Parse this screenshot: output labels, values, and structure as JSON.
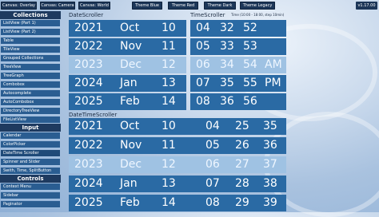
{
  "topbar": {
    "buttons": [
      "Canvas: Overlay",
      "Canvas: Camera",
      "Canvas: World",
      "Theme Blue",
      "Theme Red",
      "Theme Dark",
      "Theme Legacy"
    ],
    "version": "v1.17.00"
  },
  "sidebar": {
    "sections": [
      {
        "title": "Collections",
        "items": [
          "ListView (Part 1)",
          "ListView (Part 2)",
          "Table",
          "TileView",
          "Grouped Collections",
          "TreeView",
          "TreeGraph",
          "Combobox",
          "Autocomplete",
          "AutoCombobox",
          "DirectoryTreeView",
          "FileListView"
        ]
      },
      {
        "title": "Input",
        "items": [
          "Calendar",
          "ColorPicker",
          "DateTime Scroller",
          "Spinner and Slider",
          "Swith, Time, SplitButton"
        ]
      },
      {
        "title": "Controls",
        "items": [
          "Context Menu",
          "Sidebar",
          "Paginator"
        ]
      }
    ]
  },
  "date_scroller": {
    "label": "DateScroller",
    "rows": [
      [
        "2021",
        "Oct",
        "10"
      ],
      [
        "2022",
        "Nov",
        "11"
      ],
      [
        "2023",
        "Dec",
        "12"
      ],
      [
        "2024",
        "Jan",
        "13"
      ],
      [
        "2025",
        "Feb",
        "14"
      ]
    ],
    "selected_index": 2
  },
  "time_scroller": {
    "label": "TimeScroller",
    "hint": "Time (10:00 - 18:00, step 10min)",
    "rows": [
      [
        "04",
        "32",
        "52",
        ""
      ],
      [
        "05",
        "33",
        "53",
        ""
      ],
      [
        "06",
        "34",
        "54",
        "AM"
      ],
      [
        "07",
        "35",
        "55",
        "PM"
      ],
      [
        "08",
        "36",
        "56",
        ""
      ]
    ],
    "selected_index": 2
  },
  "datetime_scroller": {
    "label": "DateTimeScroller",
    "rows": [
      [
        "2021",
        "Oct",
        "10",
        "04",
        "25",
        "35"
      ],
      [
        "2022",
        "Nov",
        "11",
        "05",
        "26",
        "36"
      ],
      [
        "2023",
        "Dec",
        "12",
        "06",
        "27",
        "37"
      ],
      [
        "2024",
        "Jan",
        "13",
        "07",
        "28",
        "38"
      ],
      [
        "2025",
        "Feb",
        "14",
        "08",
        "29",
        "39"
      ]
    ],
    "selected_index": 2
  }
}
